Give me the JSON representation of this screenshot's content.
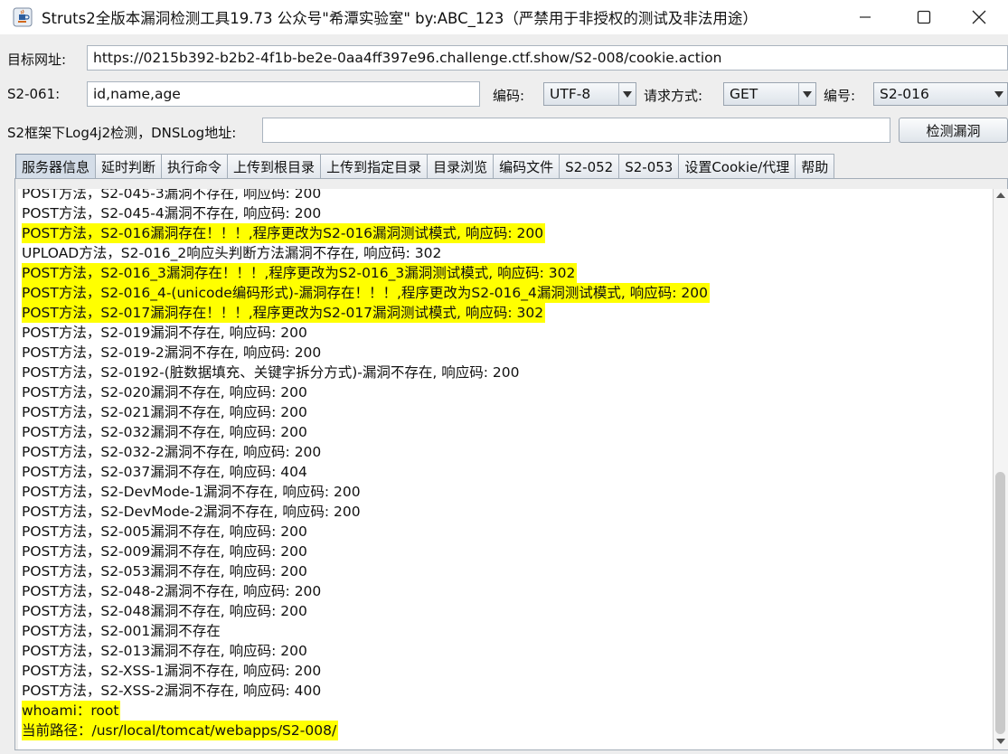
{
  "window": {
    "title": "Struts2全版本漏洞检测工具19.73 公众号\"希潭实验室\" by:ABC_123（严禁用于非授权的测试及非法用途）"
  },
  "form": {
    "target_label": "目标网址:",
    "target_value": "https://0215b392-b2b2-4f1b-be2e-0aa4ff397e96.challenge.ctf.show/S2-008/cookie.action",
    "s2061_label": "S2-061:",
    "s2061_value": "id,name,age",
    "encoding_label": "编码:",
    "encoding_value": "UTF-8",
    "method_label": "请求方式:",
    "method_value": "GET",
    "number_label": "编号:",
    "number_value": "S2-016",
    "log4j_label": "S2框架下Log4j2检测，DNSLog地址:",
    "log4j_value": "",
    "detect_button": "检测漏洞"
  },
  "tabs": [
    {
      "label": "服务器信息"
    },
    {
      "label": "延时判断"
    },
    {
      "label": "执行命令"
    },
    {
      "label": "上传到根目录"
    },
    {
      "label": "上传到指定目录"
    },
    {
      "label": "目录浏览"
    },
    {
      "label": "编码文件"
    },
    {
      "label": "S2-052"
    },
    {
      "label": "S2-053"
    },
    {
      "label": "设置Cookie/代理"
    },
    {
      "label": "帮助"
    }
  ],
  "log": [
    {
      "text": "POST方法，S2-045-3漏洞不存在, 响应码: 200",
      "hl": false
    },
    {
      "text": "POST方法，S2-045-4漏洞不存在, 响应码: 200",
      "hl": false
    },
    {
      "text": "POST方法，S2-016漏洞存在！！！,程序更改为S2-016漏洞测试模式, 响应码: 200",
      "hl": true
    },
    {
      "text": "UPLOAD方法，S2-016_2响应头判断方法漏洞不存在, 响应码: 302",
      "hl": false
    },
    {
      "text": "POST方法，S2-016_3漏洞存在！！！,程序更改为S2-016_3漏洞测试模式, 响应码: 302",
      "hl": true
    },
    {
      "text": "POST方法，S2-016_4-(unicode编码形式)-漏洞存在！！！,程序更改为S2-016_4漏洞测试模式, 响应码: 200",
      "hl": true
    },
    {
      "text": "POST方法，S2-017漏洞存在！！！,程序更改为S2-017漏洞测试模式, 响应码: 302",
      "hl": true
    },
    {
      "text": "POST方法，S2-019漏洞不存在, 响应码: 200",
      "hl": false
    },
    {
      "text": "POST方法，S2-019-2漏洞不存在, 响应码: 200",
      "hl": false
    },
    {
      "text": "POST方法，S2-0192-(脏数据填充、关键字拆分方式)-漏洞不存在, 响应码: 200",
      "hl": false
    },
    {
      "text": "POST方法，S2-020漏洞不存在, 响应码: 200",
      "hl": false
    },
    {
      "text": "POST方法，S2-021漏洞不存在, 响应码: 200",
      "hl": false
    },
    {
      "text": "POST方法，S2-032漏洞不存在, 响应码: 200",
      "hl": false
    },
    {
      "text": "POST方法，S2-032-2漏洞不存在, 响应码: 200",
      "hl": false
    },
    {
      "text": "POST方法，S2-037漏洞不存在, 响应码: 404",
      "hl": false
    },
    {
      "text": "POST方法，S2-DevMode-1漏洞不存在, 响应码: 200",
      "hl": false
    },
    {
      "text": "POST方法，S2-DevMode-2漏洞不存在, 响应码: 200",
      "hl": false
    },
    {
      "text": "POST方法，S2-005漏洞不存在, 响应码: 200",
      "hl": false
    },
    {
      "text": "POST方法，S2-009漏洞不存在, 响应码: 200",
      "hl": false
    },
    {
      "text": "POST方法，S2-053漏洞不存在, 响应码: 200",
      "hl": false
    },
    {
      "text": "POST方法，S2-048-2漏洞不存在, 响应码: 200",
      "hl": false
    },
    {
      "text": "POST方法，S2-048漏洞不存在, 响应码: 200",
      "hl": false
    },
    {
      "text": "POST方法，S2-001漏洞不存在",
      "hl": false
    },
    {
      "text": "POST方法，S2-013漏洞不存在, 响应码: 200",
      "hl": false
    },
    {
      "text": "POST方法，S2-XSS-1漏洞不存在, 响应码: 200",
      "hl": false
    },
    {
      "text": "POST方法，S2-XSS-2漏洞不存在, 响应码: 400",
      "hl": false
    },
    {
      "text": "whoami：root",
      "hl": true
    },
    {
      "text": "当前路径：/usr/local/tomcat/webapps/S2-008/",
      "hl": true
    }
  ],
  "colors": {
    "highlight": "#ffff00",
    "active_tab": "#d4dde8"
  }
}
